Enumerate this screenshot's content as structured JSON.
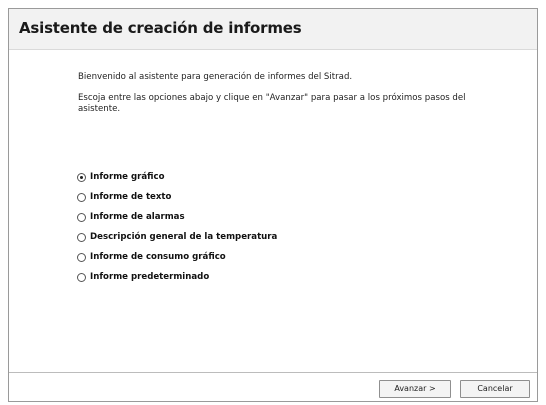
{
  "header": {
    "title": "Asistente de creación de informes"
  },
  "intro": {
    "welcome": "Bienvenido al asistente para generación de informes del Sitrad.",
    "instructions": "Escoja entre las opciones abajo y clique en \"Avanzar\" para pasar a los próximos pasos del asistente."
  },
  "options": {
    "selected": "Informe gráfico",
    "items": [
      {
        "label": "Informe gráfico",
        "checked": true
      },
      {
        "label": "Informe de texto",
        "checked": false
      },
      {
        "label": "Informe de alarmas",
        "checked": false
      },
      {
        "label": "Descripción general de la temperatura",
        "checked": false
      },
      {
        "label": "Informe de consumo gráfico",
        "checked": false
      },
      {
        "label": "Informe predeterminado",
        "checked": false
      }
    ]
  },
  "footer": {
    "next_label": "Avanzar  >",
    "cancel_label": "Cancelar"
  }
}
